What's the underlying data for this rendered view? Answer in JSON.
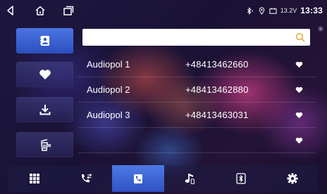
{
  "status_bar": {
    "nav_icons": [
      "back-icon",
      "home-icon",
      "recents-icon"
    ],
    "status_icons": [
      "bluetooth-icon",
      "location-icon",
      "battery-icon"
    ],
    "voltage": "13.2V",
    "time": "13:33"
  },
  "sidebar": {
    "items": [
      {
        "name": "contacts",
        "icon": "contacts-book-icon",
        "active": true
      },
      {
        "name": "favorites",
        "icon": "heart-icon",
        "active": false
      },
      {
        "name": "download",
        "icon": "download-icon",
        "active": false
      },
      {
        "name": "delete",
        "icon": "trash-icon",
        "active": false
      }
    ]
  },
  "search": {
    "value": "",
    "placeholder": ""
  },
  "contacts": [
    {
      "name": "Audiopol  1",
      "number": "+48413462660"
    },
    {
      "name": "Audiopol  2",
      "number": "+48413462880"
    },
    {
      "name": "Audiopol  3",
      "number": "+48413463031"
    },
    {
      "name": "",
      "number": ""
    }
  ],
  "bottom_tabs": [
    {
      "name": "keypad",
      "icon": "dialpad-icon",
      "active": false
    },
    {
      "name": "call-log",
      "icon": "call-log-icon",
      "active": false
    },
    {
      "name": "contacts",
      "icon": "contacts-icon",
      "active": true
    },
    {
      "name": "music",
      "icon": "music-note-icon",
      "active": false
    },
    {
      "name": "bluetooth",
      "icon": "bluetooth-icon",
      "active": false
    },
    {
      "name": "settings",
      "icon": "gear-icon",
      "active": false
    }
  ],
  "colors": {
    "accent": "#3d64d6",
    "favorite": "#ffffff"
  }
}
